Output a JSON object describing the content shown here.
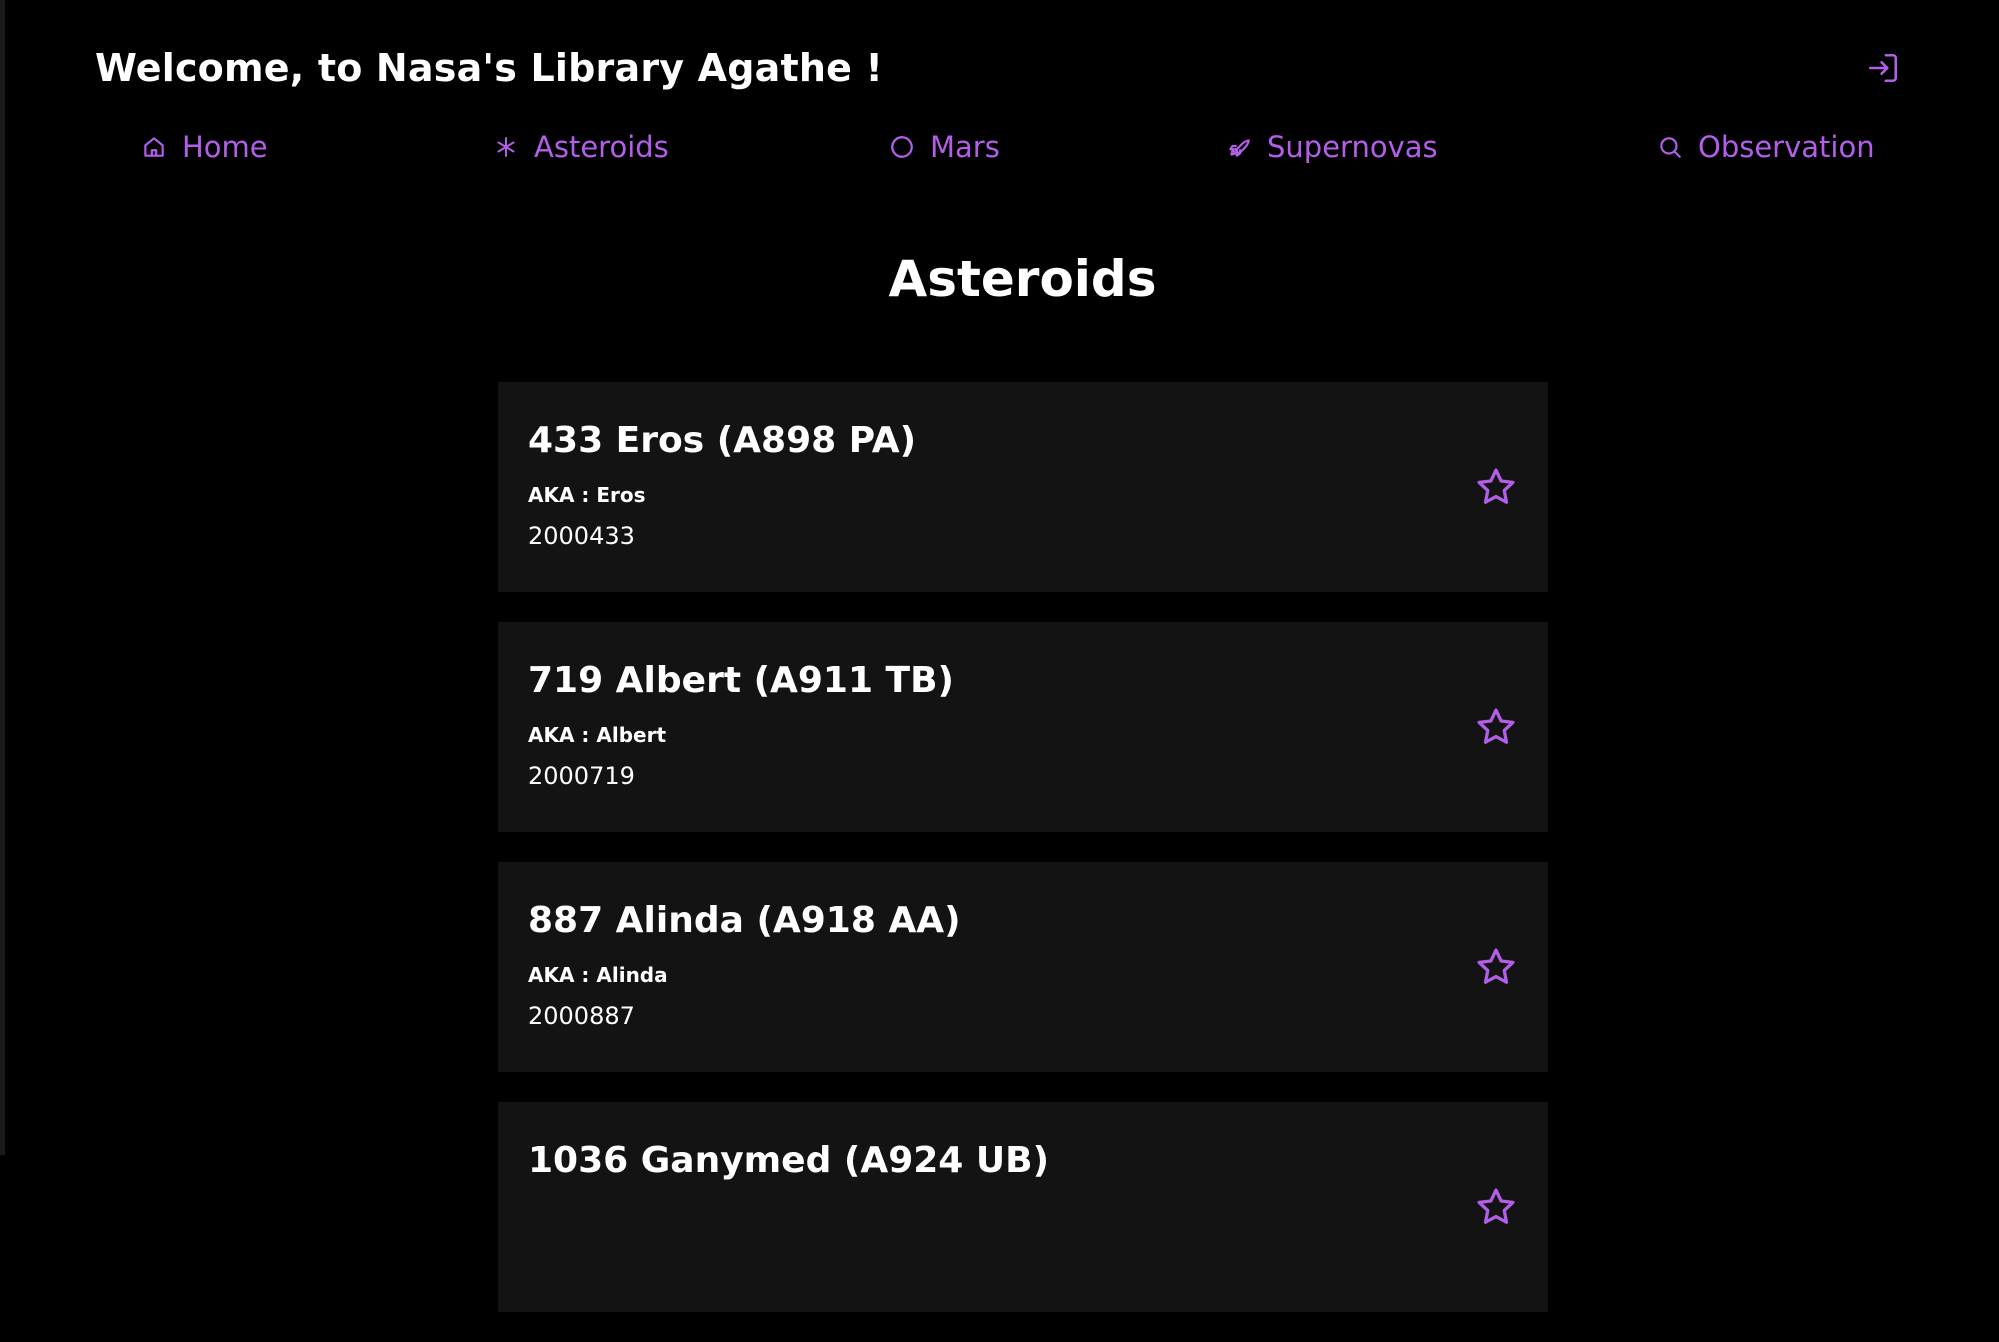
{
  "header": {
    "welcome": "Welcome, to Nasa's Library Agathe !",
    "logout_icon": "logout-icon"
  },
  "nav": {
    "items": [
      {
        "label": "Home",
        "icon": "home-icon"
      },
      {
        "label": "Asteroids",
        "icon": "asterisk-icon"
      },
      {
        "label": "Mars",
        "icon": "moon-icon"
      },
      {
        "label": "Supernovas",
        "icon": "rocket-icon"
      },
      {
        "label": "Observation",
        "icon": "search-icon"
      }
    ]
  },
  "main": {
    "title": "Asteroids",
    "asteroids": [
      {
        "name": "433 Eros (A898 PA)",
        "aka": "AKA : Eros",
        "id": "2000433"
      },
      {
        "name": "719 Albert (A911 TB)",
        "aka": "AKA : Albert",
        "id": "2000719"
      },
      {
        "name": "887 Alinda (A918 AA)",
        "aka": "AKA : Alinda",
        "id": "2000887"
      },
      {
        "name": "1036 Ganymed (A924 UB)",
        "aka": "",
        "id": ""
      }
    ]
  },
  "colors": {
    "accent": "#b35ee8",
    "background": "#000000",
    "card": "#131313"
  }
}
